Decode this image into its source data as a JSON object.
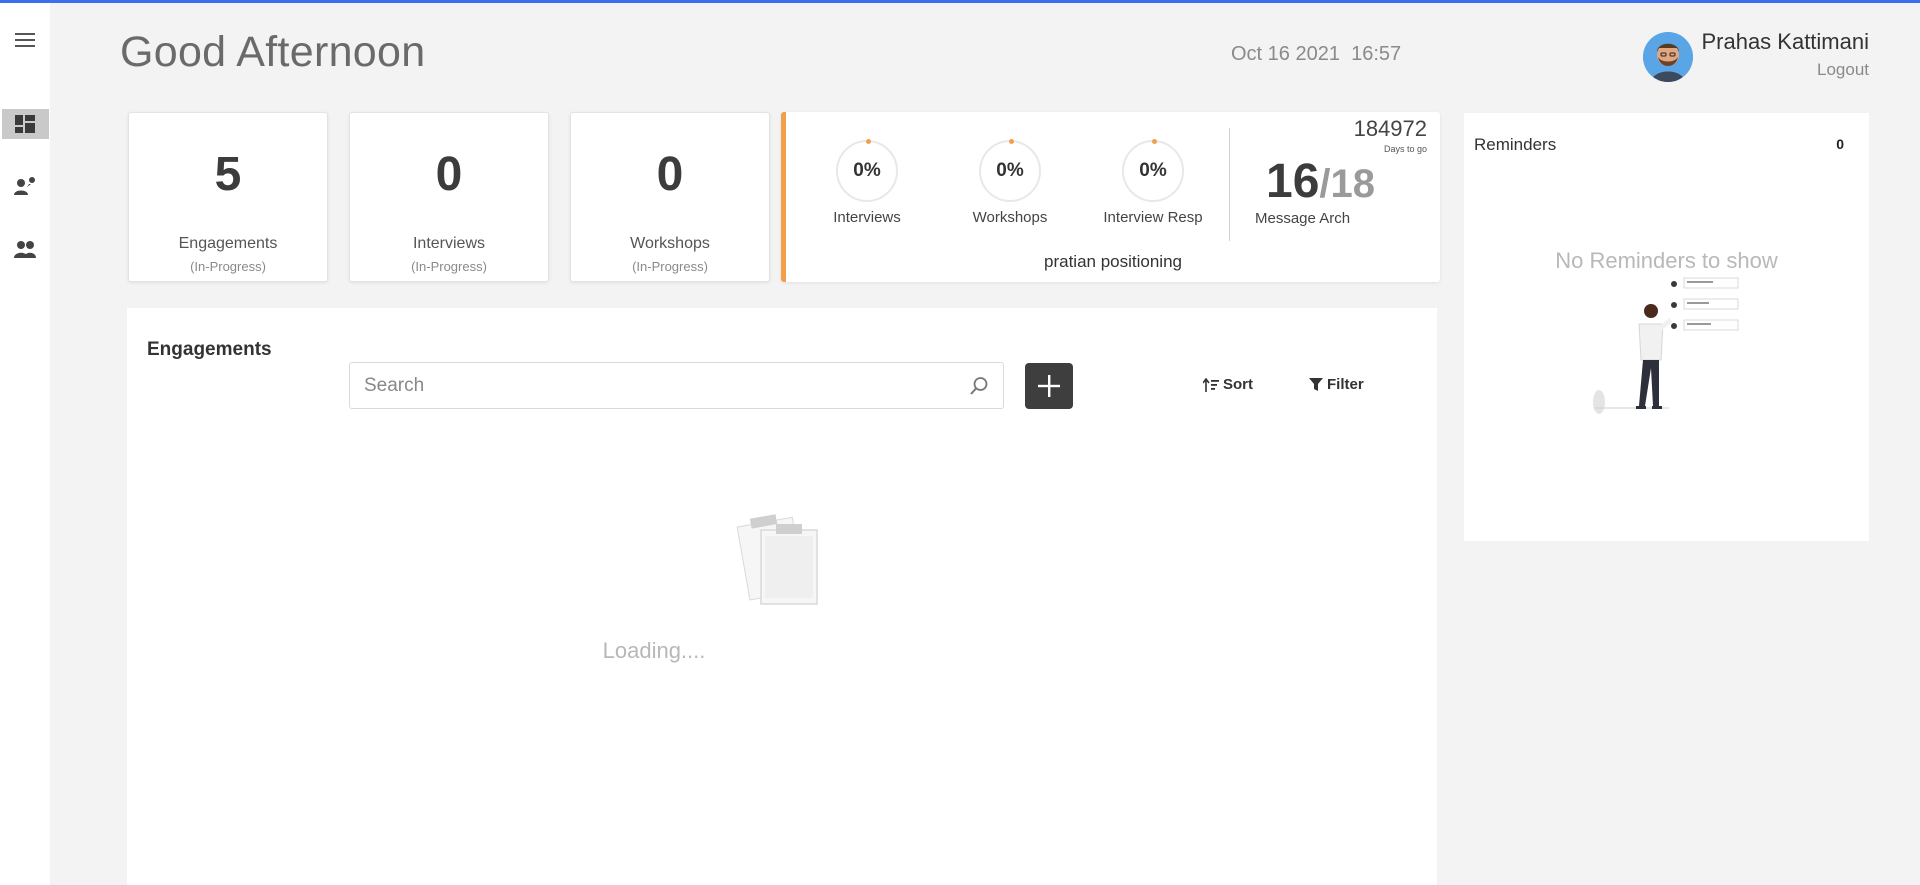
{
  "header": {
    "greeting": "Good Afternoon",
    "datetime": "Oct 16 2021  16:57",
    "user_name": "Prahas Kattimani",
    "logout_label": "Logout"
  },
  "sidebar": {
    "items": [
      {
        "icon": "menu-icon"
      },
      {
        "icon": "dashboard-icon",
        "active": true
      },
      {
        "icon": "person-chat-icon"
      },
      {
        "icon": "people-icon"
      }
    ]
  },
  "stats": [
    {
      "value": "5",
      "label": "Engagements",
      "sub": "(In-Progress)"
    },
    {
      "value": "0",
      "label": "Interviews",
      "sub": "(In-Progress)"
    },
    {
      "value": "0",
      "label": "Workshops",
      "sub": "(In-Progress)"
    }
  ],
  "progress": {
    "items": [
      {
        "percent": "0%",
        "label": "Interviews"
      },
      {
        "percent": "0%",
        "label": "Workshops"
      },
      {
        "percent": "0%",
        "label": "Interview Resp"
      }
    ],
    "days_to_go_value": "184972",
    "days_to_go_label": "Days to go",
    "message_arch_done": "16",
    "message_arch_total": "/18",
    "message_arch_label": "Message Arch",
    "project_name": "pratian positioning",
    "accent_color": "#f0a04b"
  },
  "reminders": {
    "title": "Reminders",
    "count": "0",
    "empty_text": "No Reminders to show"
  },
  "engagements": {
    "title": "Engagements",
    "search_placeholder": "Search",
    "sort_label": "Sort",
    "filter_label": "Filter",
    "loading_text": "Loading...."
  }
}
